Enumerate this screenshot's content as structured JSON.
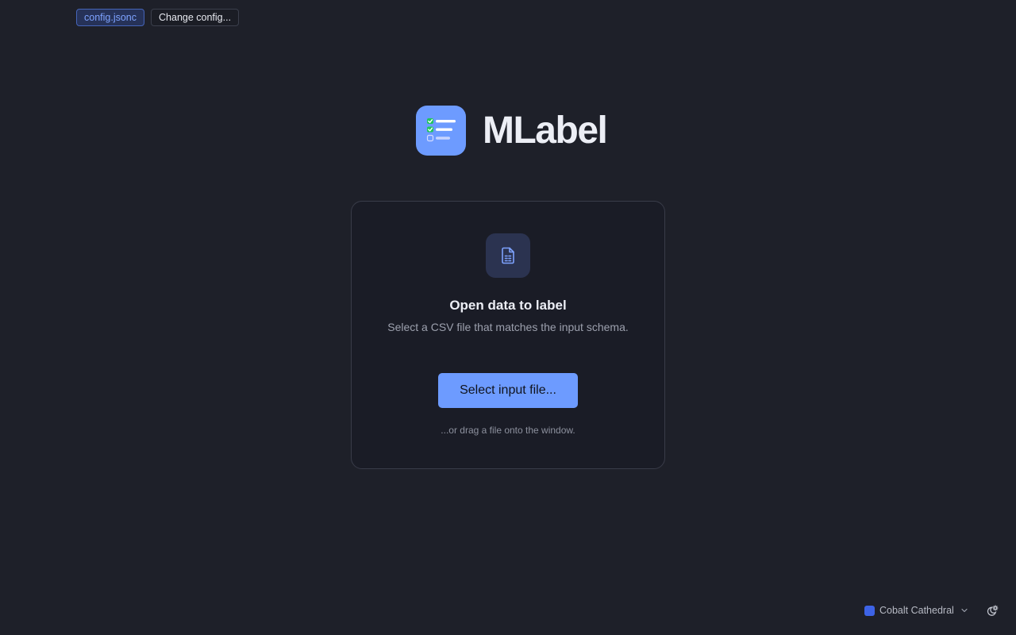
{
  "toolbar": {
    "config_file": "config.jsonc",
    "change_config_label": "Change config..."
  },
  "brand": {
    "name": "MLabel",
    "logo_icon": "checklist-icon"
  },
  "card": {
    "icon": "spreadsheet-file-icon",
    "title": "Open data to label",
    "subtitle": "Select a CSV file that matches the input schema.",
    "button_label": "Select input file...",
    "hint": "...or drag a file onto the window."
  },
  "footer": {
    "theme_name": "Cobalt Cathedral",
    "theme_color": "#3d63e6",
    "theme_dropdown_icon": "chevron-down-icon",
    "mode_toggle_icon": "theme-toggle-icon"
  },
  "colors": {
    "background": "#1e2029",
    "accent": "#6d9bff"
  }
}
